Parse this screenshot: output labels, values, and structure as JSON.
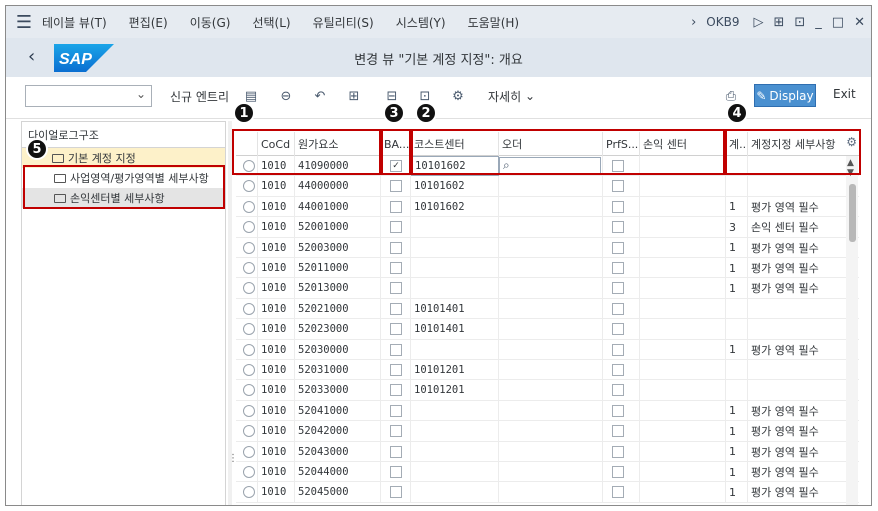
{
  "menu": {
    "items": [
      "테이블 뷰(T)",
      "편집(E)",
      "이동(G)",
      "선택(L)",
      "유틸리티(S)",
      "시스템(Y)",
      "도움말(H)"
    ],
    "tcode": "OKB9"
  },
  "titlebar": {
    "logo": "SAP",
    "title": "변경 뷰 \"기본 계정 지정\": 개요"
  },
  "toolbar": {
    "new_entries": "신규 엔트리",
    "details": "자세히",
    "display": "Display",
    "exit": "Exit"
  },
  "tree": {
    "header": "다이얼로그구조",
    "root": "기본 계정 지정",
    "children": [
      "사업영역/평가영역별 세부사항",
      "손익센터별 세부사항"
    ]
  },
  "table": {
    "headers": {
      "cocd": "CoCd",
      "gl": "원가요소",
      "ba": "BA...",
      "cc": "코스트센터",
      "order": "오더",
      "prfs": "PrfS...",
      "pc": "손익 센터",
      "ct": "계..",
      "detail": "계정지정 세부사항"
    },
    "rows": [
      {
        "cocd": "1010",
        "gl": "41090000",
        "ba": true,
        "cc": "10101602",
        "ct": "",
        "detail": ""
      },
      {
        "cocd": "1010",
        "gl": "44000000",
        "ba": false,
        "cc": "10101602",
        "ct": "",
        "detail": ""
      },
      {
        "cocd": "1010",
        "gl": "44001000",
        "ba": false,
        "cc": "10101602",
        "ct": "1",
        "detail": "평가 영역 필수"
      },
      {
        "cocd": "1010",
        "gl": "52001000",
        "ba": false,
        "cc": "",
        "ct": "3",
        "detail": "손익 센터 필수"
      },
      {
        "cocd": "1010",
        "gl": "52003000",
        "ba": false,
        "cc": "",
        "ct": "1",
        "detail": "평가 영역 필수"
      },
      {
        "cocd": "1010",
        "gl": "52011000",
        "ba": false,
        "cc": "",
        "ct": "1",
        "detail": "평가 영역 필수"
      },
      {
        "cocd": "1010",
        "gl": "52013000",
        "ba": false,
        "cc": "",
        "ct": "1",
        "detail": "평가 영역 필수"
      },
      {
        "cocd": "1010",
        "gl": "52021000",
        "ba": false,
        "cc": "10101401",
        "ct": "",
        "detail": ""
      },
      {
        "cocd": "1010",
        "gl": "52023000",
        "ba": false,
        "cc": "10101401",
        "ct": "",
        "detail": ""
      },
      {
        "cocd": "1010",
        "gl": "52030000",
        "ba": false,
        "cc": "",
        "ct": "1",
        "detail": "평가 영역 필수"
      },
      {
        "cocd": "1010",
        "gl": "52031000",
        "ba": false,
        "cc": "10101201",
        "ct": "",
        "detail": ""
      },
      {
        "cocd": "1010",
        "gl": "52033000",
        "ba": false,
        "cc": "10101201",
        "ct": "",
        "detail": ""
      },
      {
        "cocd": "1010",
        "gl": "52041000",
        "ba": false,
        "cc": "",
        "ct": "1",
        "detail": "평가 영역 필수"
      },
      {
        "cocd": "1010",
        "gl": "52042000",
        "ba": false,
        "cc": "",
        "ct": "1",
        "detail": "평가 영역 필수"
      },
      {
        "cocd": "1010",
        "gl": "52043000",
        "ba": false,
        "cc": "",
        "ct": "1",
        "detail": "평가 영역 필수"
      },
      {
        "cocd": "1010",
        "gl": "52044000",
        "ba": false,
        "cc": "",
        "ct": "1",
        "detail": "평가 영역 필수"
      },
      {
        "cocd": "1010",
        "gl": "52045000",
        "ba": false,
        "cc": "",
        "ct": "1",
        "detail": "평가 영역 필수"
      }
    ]
  },
  "badges": [
    "1",
    "2",
    "3",
    "4",
    "5"
  ],
  "colors": {
    "annotation": "#c00000",
    "accent": "#4a90d0",
    "selection": "#fdf1c9"
  }
}
